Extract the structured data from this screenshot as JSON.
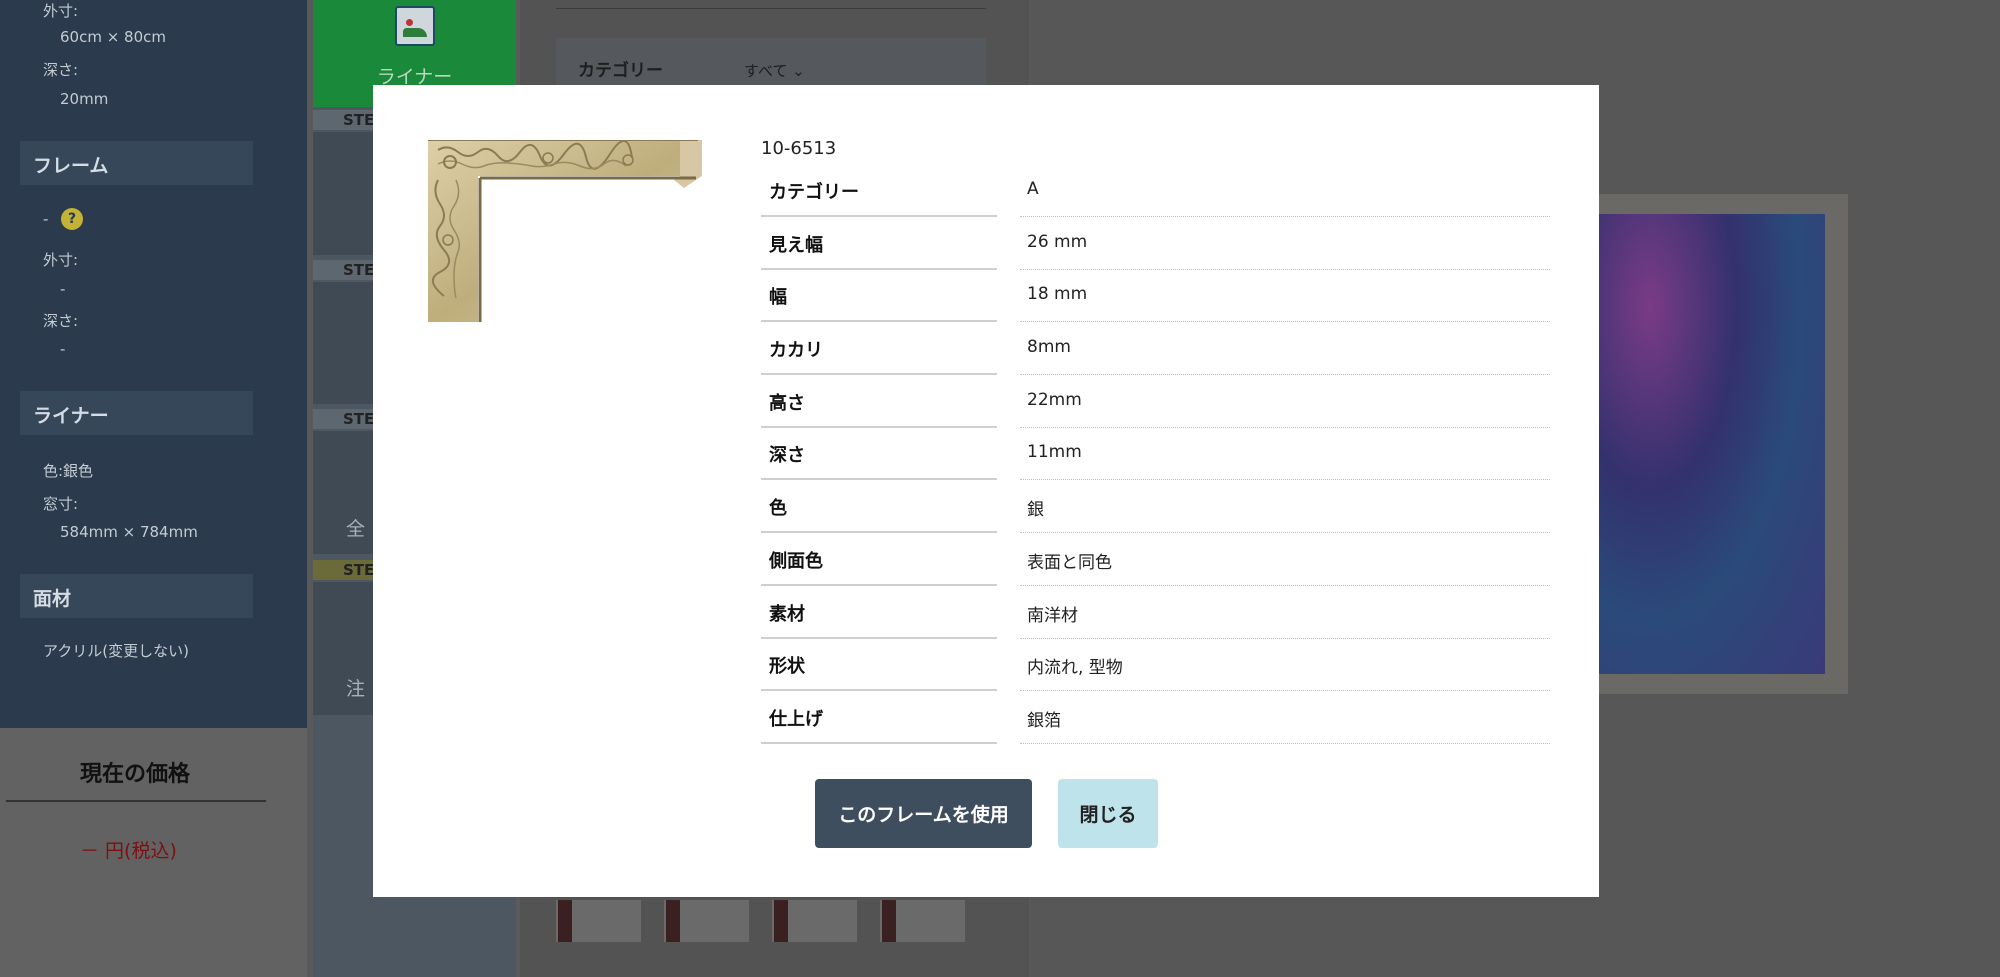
{
  "background": {
    "sidebar": {
      "outer_label": "外寸:",
      "outer_value": "60cm × 80cm",
      "depth_label": "深さ:",
      "depth_value": "20mm",
      "frame_heading": "フレーム",
      "frame_value": "-",
      "frame_outer_label": "外寸:",
      "frame_outer_value": "-",
      "frame_depth_label": "深さ:",
      "frame_depth_value": "-",
      "liner_heading": "ライナー",
      "liner_color": "色:銀色",
      "liner_window_label": "窓寸:",
      "liner_window_value": "584mm × 784mm",
      "material_heading": "面材",
      "material_value": "アクリル(変更しない)"
    },
    "price": {
      "title": "現在の価格",
      "value": "－ 円(税込)"
    },
    "steps": {
      "liner_label": "ライナー",
      "tag1": "STE",
      "tag2": "STE",
      "tag3": "STE",
      "tag4": "STE",
      "text1": "全",
      "text2": "注"
    },
    "category": {
      "label": "カテゴリー",
      "selected": "すべて"
    }
  },
  "modal": {
    "code": "10-6513",
    "specs": [
      {
        "key": "カテゴリー",
        "value": "A"
      },
      {
        "key": "見え幅",
        "value": "26 mm"
      },
      {
        "key": "幅",
        "value": "18 mm"
      },
      {
        "key": "カカリ",
        "value": "8mm"
      },
      {
        "key": "高さ",
        "value": "22mm"
      },
      {
        "key": "深さ",
        "value": "11mm"
      },
      {
        "key": "色",
        "value": "銀"
      },
      {
        "key": "側面色",
        "value": "表面と同色"
      },
      {
        "key": "素材",
        "value": "南洋材"
      },
      {
        "key": "形状",
        "value": "内流れ, 型物"
      },
      {
        "key": "仕上げ",
        "value": "銀箔"
      }
    ],
    "use_button": "このフレームを使用",
    "close_button": "閉じる"
  },
  "icons": {
    "help": "question-icon",
    "chevron": "chevron-down-icon",
    "image": "image-icon"
  },
  "colors": {
    "primary_button": "#3f4e5f",
    "secondary_button": "#bfe3ea",
    "price": "#c0192c",
    "step_active": "#1a8a3a"
  }
}
